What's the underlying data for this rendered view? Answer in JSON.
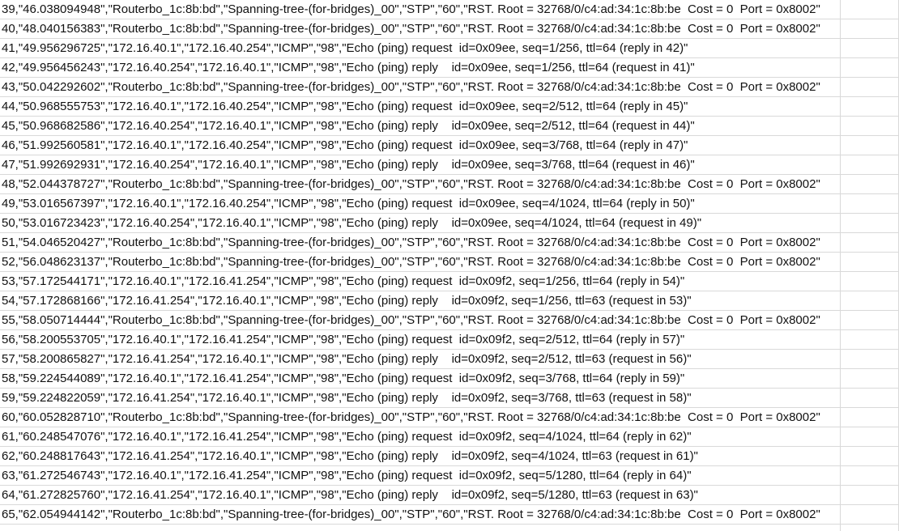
{
  "sheet": {
    "rows": [
      "39,\"46.038094948\",\"Routerbo_1c:8b:bd\",\"Spanning-tree-(for-bridges)_00\",\"STP\",\"60\",\"RST. Root = 32768/0/c4:ad:34:1c:8b:be  Cost = 0  Port = 0x8002\"",
      "40,\"48.040156383\",\"Routerbo_1c:8b:bd\",\"Spanning-tree-(for-bridges)_00\",\"STP\",\"60\",\"RST. Root = 32768/0/c4:ad:34:1c:8b:be  Cost = 0  Port = 0x8002\"",
      "41,\"49.956296725\",\"172.16.40.1\",\"172.16.40.254\",\"ICMP\",\"98\",\"Echo (ping) request  id=0x09ee, seq=1/256, ttl=64 (reply in 42)\"",
      "42,\"49.956456243\",\"172.16.40.254\",\"172.16.40.1\",\"ICMP\",\"98\",\"Echo (ping) reply    id=0x09ee, seq=1/256, ttl=64 (request in 41)\"",
      "43,\"50.042292602\",\"Routerbo_1c:8b:bd\",\"Spanning-tree-(for-bridges)_00\",\"STP\",\"60\",\"RST. Root = 32768/0/c4:ad:34:1c:8b:be  Cost = 0  Port = 0x8002\"",
      "44,\"50.968555753\",\"172.16.40.1\",\"172.16.40.254\",\"ICMP\",\"98\",\"Echo (ping) request  id=0x09ee, seq=2/512, ttl=64 (reply in 45)\"",
      "45,\"50.968682586\",\"172.16.40.254\",\"172.16.40.1\",\"ICMP\",\"98\",\"Echo (ping) reply    id=0x09ee, seq=2/512, ttl=64 (request in 44)\"",
      "46,\"51.992560581\",\"172.16.40.1\",\"172.16.40.254\",\"ICMP\",\"98\",\"Echo (ping) request  id=0x09ee, seq=3/768, ttl=64 (reply in 47)\"",
      "47,\"51.992692931\",\"172.16.40.254\",\"172.16.40.1\",\"ICMP\",\"98\",\"Echo (ping) reply    id=0x09ee, seq=3/768, ttl=64 (request in 46)\"",
      "48,\"52.044378727\",\"Routerbo_1c:8b:bd\",\"Spanning-tree-(for-bridges)_00\",\"STP\",\"60\",\"RST. Root = 32768/0/c4:ad:34:1c:8b:be  Cost = 0  Port = 0x8002\"",
      "49,\"53.016567397\",\"172.16.40.1\",\"172.16.40.254\",\"ICMP\",\"98\",\"Echo (ping) request  id=0x09ee, seq=4/1024, ttl=64 (reply in 50)\"",
      "50,\"53.016723423\",\"172.16.40.254\",\"172.16.40.1\",\"ICMP\",\"98\",\"Echo (ping) reply    id=0x09ee, seq=4/1024, ttl=64 (request in 49)\"",
      "51,\"54.046520427\",\"Routerbo_1c:8b:bd\",\"Spanning-tree-(for-bridges)_00\",\"STP\",\"60\",\"RST. Root = 32768/0/c4:ad:34:1c:8b:be  Cost = 0  Port = 0x8002\"",
      "52,\"56.048623137\",\"Routerbo_1c:8b:bd\",\"Spanning-tree-(for-bridges)_00\",\"STP\",\"60\",\"RST. Root = 32768/0/c4:ad:34:1c:8b:be  Cost = 0  Port = 0x8002\"",
      "53,\"57.172544171\",\"172.16.40.1\",\"172.16.41.254\",\"ICMP\",\"98\",\"Echo (ping) request  id=0x09f2, seq=1/256, ttl=64 (reply in 54)\"",
      "54,\"57.172868166\",\"172.16.41.254\",\"172.16.40.1\",\"ICMP\",\"98\",\"Echo (ping) reply    id=0x09f2, seq=1/256, ttl=63 (request in 53)\"",
      "55,\"58.050714444\",\"Routerbo_1c:8b:bd\",\"Spanning-tree-(for-bridges)_00\",\"STP\",\"60\",\"RST. Root = 32768/0/c4:ad:34:1c:8b:be  Cost = 0  Port = 0x8002\"",
      "56,\"58.200553705\",\"172.16.40.1\",\"172.16.41.254\",\"ICMP\",\"98\",\"Echo (ping) request  id=0x09f2, seq=2/512, ttl=64 (reply in 57)\"",
      "57,\"58.200865827\",\"172.16.41.254\",\"172.16.40.1\",\"ICMP\",\"98\",\"Echo (ping) reply    id=0x09f2, seq=2/512, ttl=63 (request in 56)\"",
      "58,\"59.224544089\",\"172.16.40.1\",\"172.16.41.254\",\"ICMP\",\"98\",\"Echo (ping) request  id=0x09f2, seq=3/768, ttl=64 (reply in 59)\"",
      "59,\"59.224822059\",\"172.16.41.254\",\"172.16.40.1\",\"ICMP\",\"98\",\"Echo (ping) reply    id=0x09f2, seq=3/768, ttl=63 (request in 58)\"",
      "60,\"60.052828710\",\"Routerbo_1c:8b:bd\",\"Spanning-tree-(for-bridges)_00\",\"STP\",\"60\",\"RST. Root = 32768/0/c4:ad:34:1c:8b:be  Cost = 0  Port = 0x8002\"",
      "61,\"60.248547076\",\"172.16.40.1\",\"172.16.41.254\",\"ICMP\",\"98\",\"Echo (ping) request  id=0x09f2, seq=4/1024, ttl=64 (reply in 62)\"",
      "62,\"60.248817643\",\"172.16.41.254\",\"172.16.40.1\",\"ICMP\",\"98\",\"Echo (ping) reply    id=0x09f2, seq=4/1024, ttl=63 (request in 61)\"",
      "63,\"61.272546743\",\"172.16.40.1\",\"172.16.41.254\",\"ICMP\",\"98\",\"Echo (ping) request  id=0x09f2, seq=5/1280, ttl=64 (reply in 64)\"",
      "64,\"61.272825760\",\"172.16.41.254\",\"172.16.40.1\",\"ICMP\",\"98\",\"Echo (ping) reply    id=0x09f2, seq=5/1280, ttl=63 (request in 63)\"",
      "65,\"62.054944142\",\"Routerbo_1c:8b:bd\",\"Spanning-tree-(for-bridges)_00\",\"STP\",\"60\",\"RST. Root = 32768/0/c4:ad:34:1c:8b:be  Cost = 0  Port = 0x8002\""
    ]
  },
  "colors": {
    "background": "#ffffff",
    "gridline": "#d9d9d9",
    "text": "#111111"
  }
}
